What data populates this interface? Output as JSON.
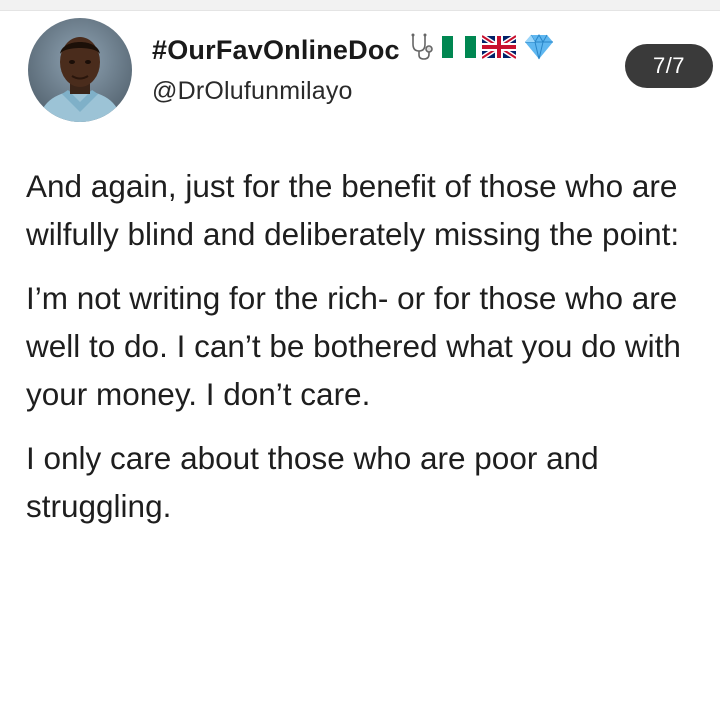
{
  "post": {
    "display_name": "#OurFavOnlineDoc",
    "handle": "@DrOlufunmilayo",
    "page_indicator": "7/7",
    "paragraphs": [
      "And again, just for the benefit of those who are wilfully blind and deliberately missing the point:",
      "I’m not writing for the rich- or for those who are well to do. I can’t be bothered what you do with your money. I don’t care.",
      "I only care about those who are poor and struggling."
    ]
  },
  "badges": [
    "stethoscope-icon",
    "nigeria-flag-icon",
    "uk-flag-icon",
    "diamond-icon"
  ],
  "colors": {
    "text": "#1e1e1e",
    "pill_bg": "#3a3a3a",
    "pill_text": "#ffffff",
    "nigeria_green": "#008751",
    "uk_blue": "#012169",
    "uk_red": "#c8102e",
    "diamond": "#5fb7f0"
  }
}
